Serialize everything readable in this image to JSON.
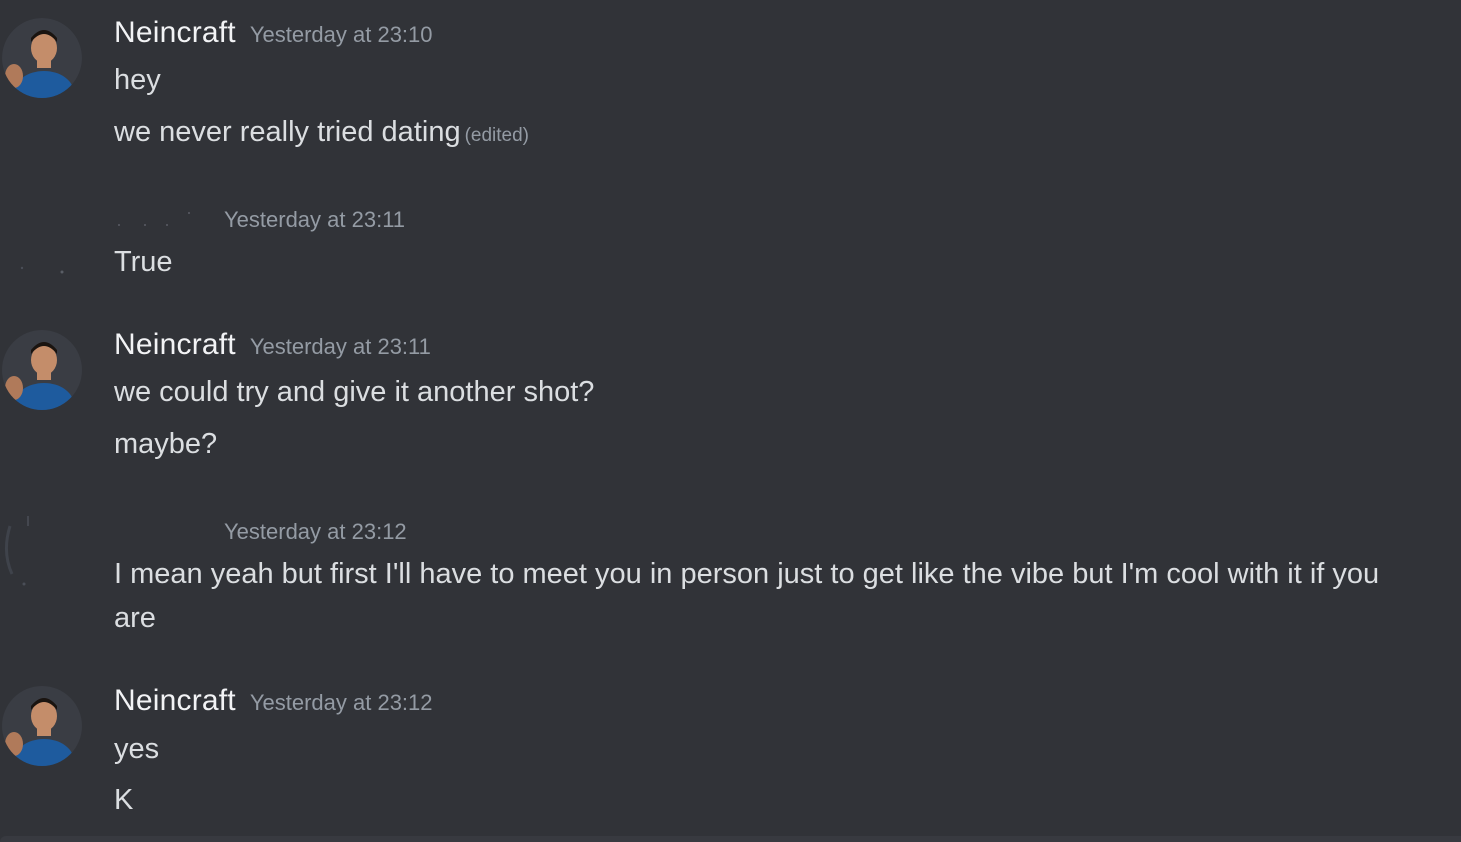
{
  "colors": {
    "background": "#313338",
    "username": "#f2f3f5",
    "timestamp": "#949ba4",
    "message_text": "#dbdee1",
    "composer": "#383a40"
  },
  "messages": [
    {
      "author": "Neincraft",
      "timestamp": "Yesterday at 23:10",
      "lines": [
        "hey",
        "we never really tried dating"
      ],
      "edited_label": "(edited)"
    },
    {
      "author": "",
      "timestamp": "Yesterday at 23:11",
      "lines": [
        "True"
      ]
    },
    {
      "author": "Neincraft",
      "timestamp": "Yesterday at 23:11",
      "lines": [
        "we could try and give it another shot?",
        "maybe?"
      ]
    },
    {
      "author": "",
      "timestamp": "Yesterday at 23:12",
      "lines": [
        "I mean yeah but first I'll have to meet you in person just to get like the vibe but I'm cool with it if you are"
      ]
    },
    {
      "author": "Neincraft",
      "timestamp": "Yesterday at 23:12",
      "lines": [
        "yes",
        "K"
      ]
    }
  ]
}
